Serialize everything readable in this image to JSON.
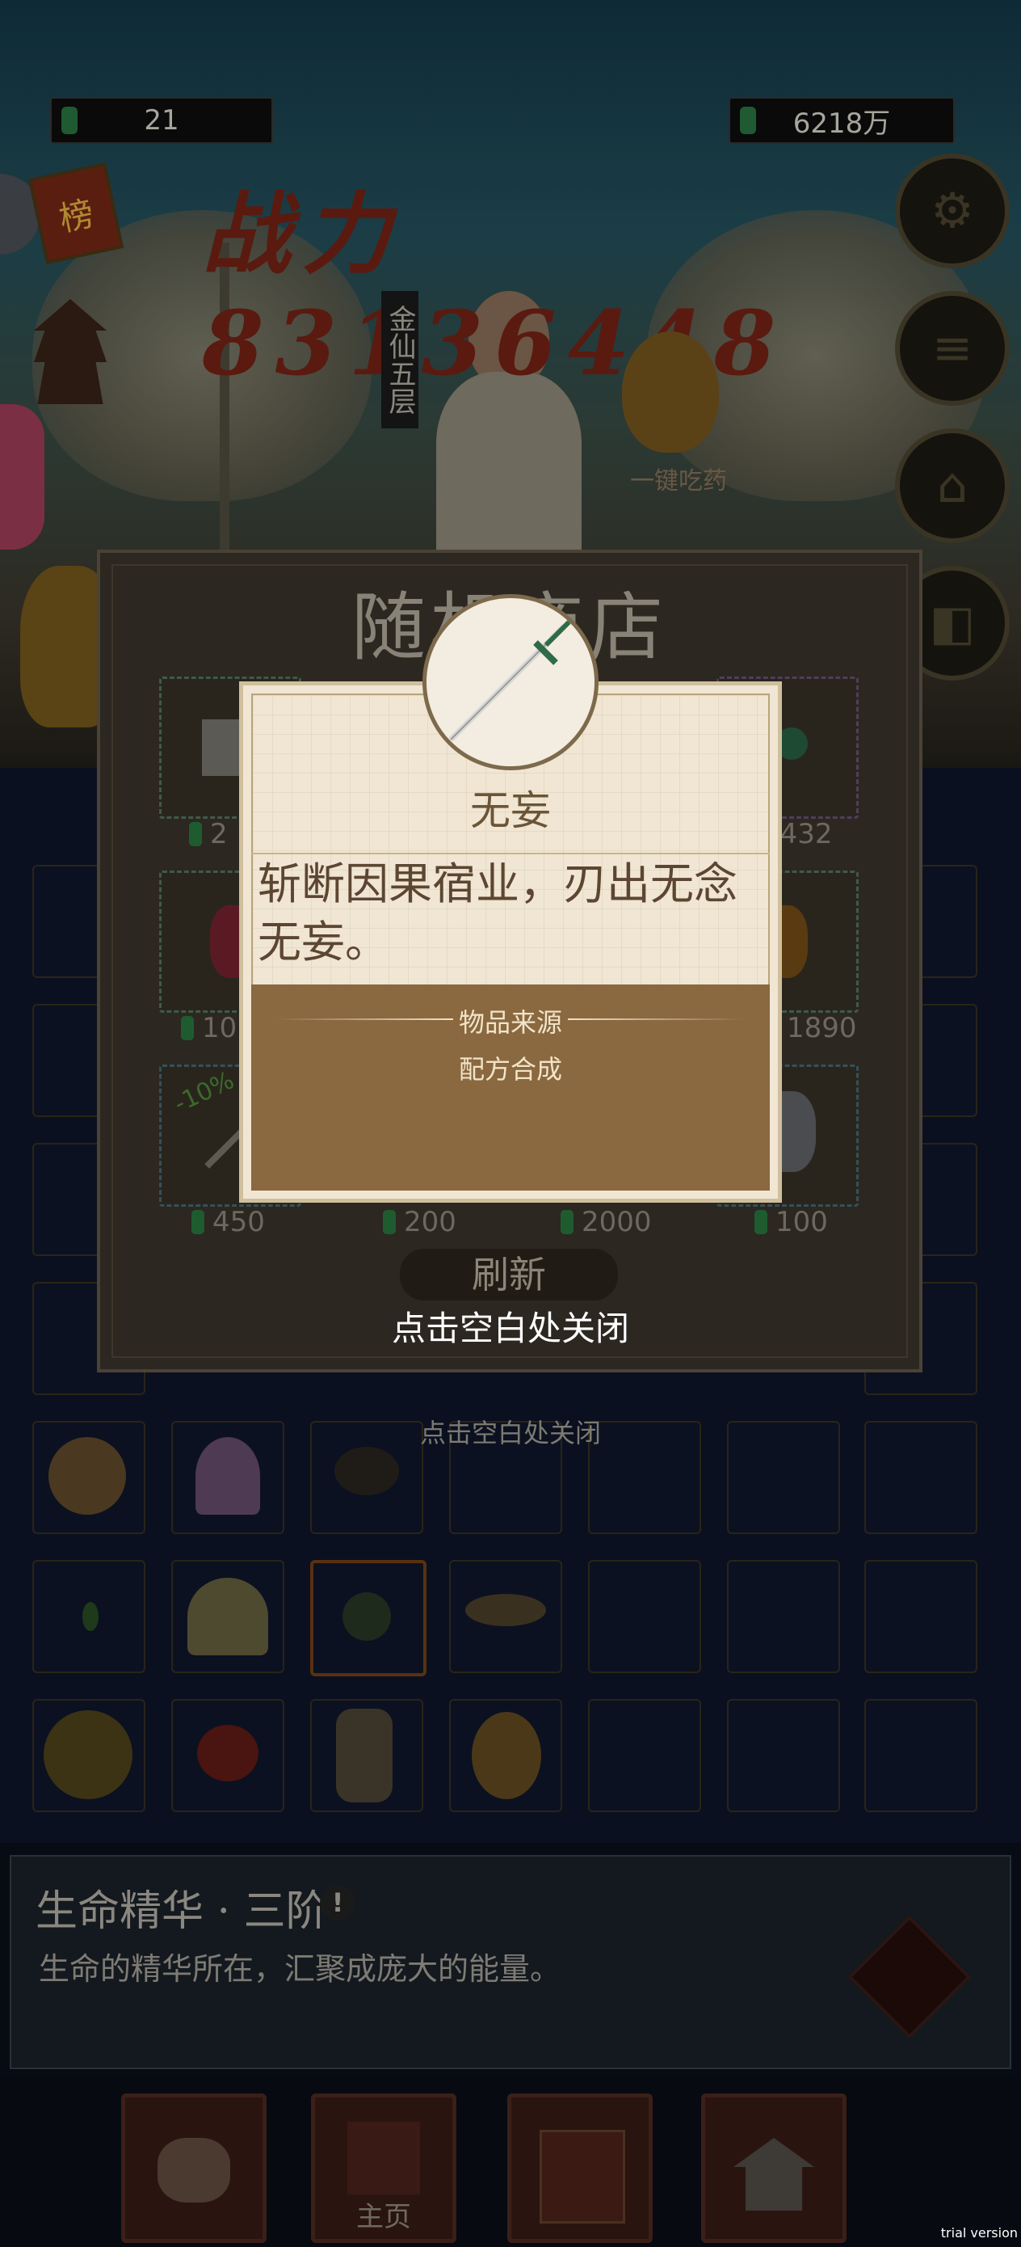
{
  "top_bar": {
    "left_value": "21",
    "right_value": "6218万"
  },
  "power_text": "战力 83136448",
  "realm_label": "金仙五层",
  "potion_label": "一键吃药",
  "side_badge": "榜",
  "shop": {
    "title": "随机商店",
    "prices_row1": [
      "2",
      "5432"
    ],
    "prices_row2": [
      "10",
      "1890"
    ],
    "prices_row3": [
      "450",
      "200",
      "2000",
      "100"
    ],
    "discount_tag": "-10%",
    "refresh_label": "刷新",
    "close_hint": "点击空白处关闭"
  },
  "detail_card": {
    "name": "无妄",
    "description": "斩断因果宿业，刃出无念无妄。",
    "source_title": "物品来源",
    "source_value": "配方合成"
  },
  "outer_close_hint": "点击空白处关闭",
  "info_panel": {
    "title": "生命精华 · 三阶",
    "description": "生命的精华所在，汇聚成庞大的能量。",
    "info_icon": "!"
  },
  "bottom_nav": {
    "items": [
      {
        "icon": "scroll-icon",
        "label": ""
      },
      {
        "icon": "gate-icon",
        "label": "主页"
      },
      {
        "icon": "book-icon",
        "label": ""
      },
      {
        "icon": "pavilion-icon",
        "label": ""
      }
    ]
  },
  "watermark": "trial version",
  "colors": {
    "gem_green": "#1f5a32",
    "power_red": "#5a1a10",
    "card_bg": "#f0e6d3",
    "card_lower": "#8a6840"
  }
}
